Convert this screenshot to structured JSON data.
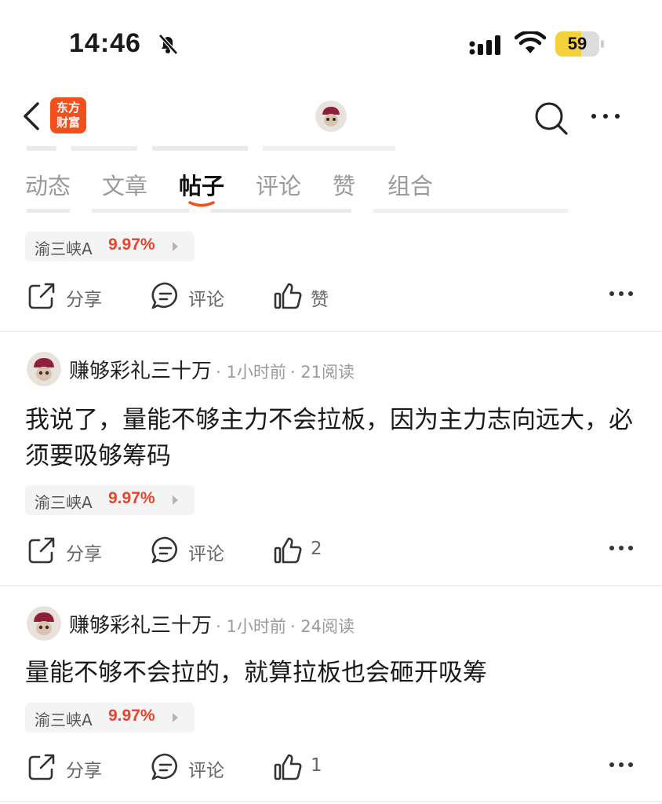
{
  "status_bar": {
    "time": "14:46",
    "battery": "59",
    "battery_level": 0.59
  },
  "app": {
    "logo_line1": "东方",
    "logo_line2": "财富",
    "brand_color": "#f1501d"
  },
  "tabs": [
    {
      "label": "动态"
    },
    {
      "label": "文章"
    },
    {
      "label": "帖子",
      "active": true
    },
    {
      "label": "评论"
    },
    {
      "label": "赞"
    },
    {
      "label": "组合"
    }
  ],
  "actions": {
    "share": "分享",
    "comment": "评论",
    "like": "赞"
  },
  "posts": [
    {
      "stock": {
        "name": "渝三峡A",
        "change": "9.97%"
      },
      "likes": "赞"
    },
    {
      "author": "赚够彩礼三十万",
      "time": "1小时前",
      "reads": "21阅读",
      "content": "我说了，量能不够主力不会拉板，因为主力志向远大，必须要吸够筹码",
      "stock": {
        "name": "渝三峡A",
        "change": "9.97%"
      },
      "likes": "2"
    },
    {
      "author": "赚够彩礼三十万",
      "time": "1小时前",
      "reads": "24阅读",
      "content": "量能不够不会拉的，就算拉板也会砸开吸筹",
      "stock": {
        "name": "渝三峡A",
        "change": "9.97%"
      },
      "likes": "1"
    }
  ],
  "colors": {
    "up_red": "#e8442d",
    "accent": "#f1501d"
  }
}
